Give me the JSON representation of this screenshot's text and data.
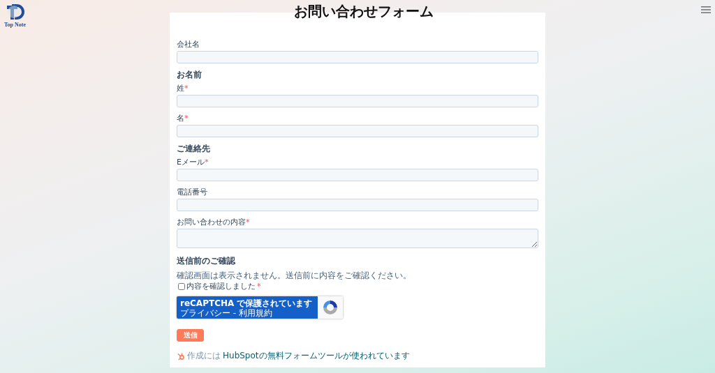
{
  "logo": {
    "text": "Top Note"
  },
  "title": "お問い合わせフォーム",
  "required_mark": "*",
  "form": [
    {
      "kind": "field",
      "label": "会社名",
      "required": false
    },
    {
      "kind": "heading",
      "label": "お名前"
    },
    {
      "kind": "field",
      "label": "姓",
      "required": true
    },
    {
      "kind": "field",
      "label": "名",
      "required": true
    },
    {
      "kind": "heading",
      "label": "ご連絡先"
    },
    {
      "kind": "field",
      "label": "Eメール",
      "required": true
    },
    {
      "kind": "field",
      "label": "電話番号",
      "required": false
    },
    {
      "kind": "textarea",
      "label": "お問い合わせの内容",
      "required": true
    },
    {
      "kind": "heading",
      "label": "送信前のご確認"
    },
    {
      "kind": "note",
      "label": "確認画面は表示されません。送信前に内容をご確認ください。"
    },
    {
      "kind": "checkbox",
      "label": "内容を確認しました",
      "required": true,
      "checked": false
    }
  ],
  "recaptcha": {
    "title": "reCAPTCHA で保護されています",
    "links": "プライバシー - 利用規約"
  },
  "submit": "送信",
  "footer": {
    "prefix": "作成には",
    "link": "HubSpotの無料フォームツールが使われています"
  }
}
